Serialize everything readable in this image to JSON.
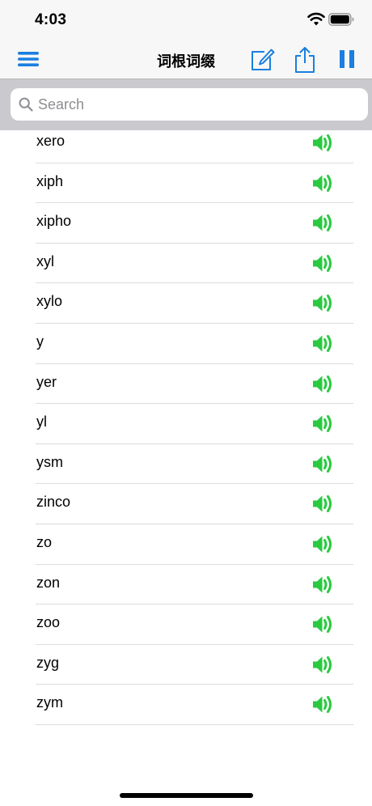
{
  "status_bar": {
    "time": "4:03"
  },
  "nav": {
    "title": "词根词缀"
  },
  "search": {
    "placeholder": "Search"
  },
  "colors": {
    "accent": "#1a7fe0",
    "speaker": "#2ac940"
  },
  "icons": {
    "menu": "menu-icon",
    "edit": "edit-icon",
    "share": "share-icon",
    "pause": "pause-icon",
    "speaker": "speaker-icon"
  },
  "list": {
    "items": [
      {
        "label": "xero"
      },
      {
        "label": "xiph"
      },
      {
        "label": "xipho"
      },
      {
        "label": "xyl"
      },
      {
        "label": "xylo"
      },
      {
        "label": "y"
      },
      {
        "label": "yer"
      },
      {
        "label": "yl"
      },
      {
        "label": "ysm"
      },
      {
        "label": "zinco"
      },
      {
        "label": "zo"
      },
      {
        "label": "zon"
      },
      {
        "label": "zoo"
      },
      {
        "label": "zyg"
      },
      {
        "label": "zym"
      }
    ]
  }
}
